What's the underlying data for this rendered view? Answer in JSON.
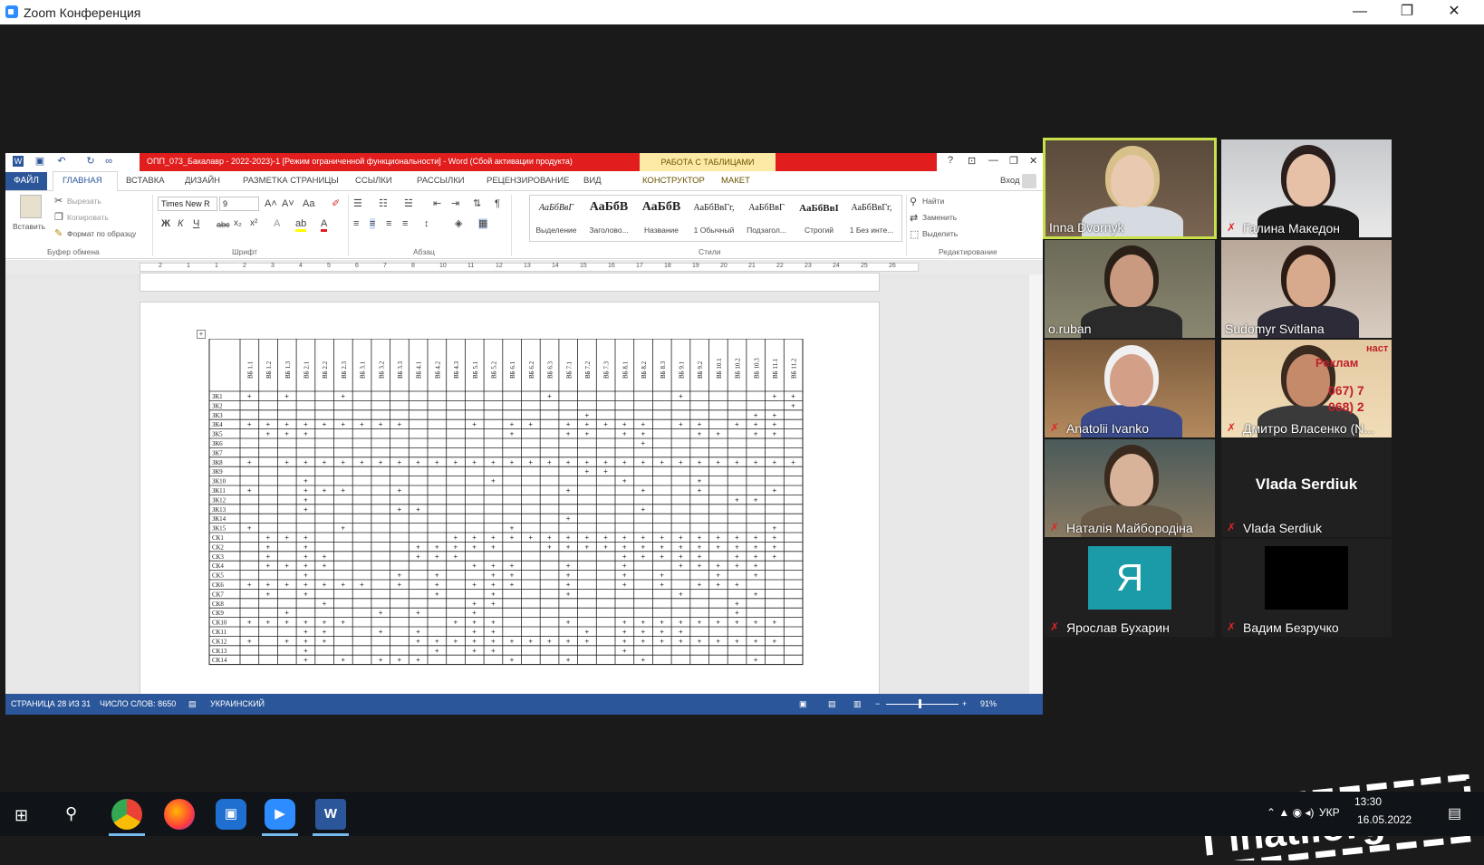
{
  "zoom": {
    "title": "Zoom Конференция",
    "controls": [
      "—",
      "❐",
      "✕"
    ]
  },
  "word": {
    "doc_title": "ОПП_073_Бакалавр - 2022-2023)-1 [Режим ограниченной функциональности] - Word (Сбой активации продукта)",
    "context_tab": "РАБОТА С ТАБЛИЦАМИ",
    "title_controls": [
      "?",
      "⊡",
      "—",
      "❐",
      "✕"
    ],
    "signin": "Вход",
    "tabs": [
      "ФАЙЛ",
      "ГЛАВНАЯ",
      "ВСТАВКА",
      "ДИЗАЙН",
      "РАЗМЕТКА СТРАНИЦЫ",
      "ССЫЛКИ",
      "РАССЫЛКИ",
      "РЕЦЕНЗИРОВАНИЕ",
      "ВИД",
      "КОНСТРУКТОР",
      "МАКЕТ"
    ],
    "clipboard": {
      "paste": "Вставить",
      "cut": "Вырезать",
      "copy": "Копировать",
      "format": "Формат по образцу",
      "group": "Буфер обмена"
    },
    "font": {
      "name": "Times New R",
      "size": "9",
      "group": "Шрифт",
      "bold": "Ж",
      "italic": "К",
      "underline": "Ч",
      "strike": "abc",
      "sub": "x₂",
      "sup": "x²"
    },
    "paragraph": {
      "group": "Абзац"
    },
    "styles": {
      "group": "Стили",
      "items": [
        {
          "preview": "АаБбВвГ",
          "name": "Выделение"
        },
        {
          "preview": "АаБбВ",
          "name": "Заголово..."
        },
        {
          "preview": "АаБбВ",
          "name": "Название"
        },
        {
          "preview": "АаБбВвГг,",
          "name": "1 Обычный"
        },
        {
          "preview": "АаБбВвГ",
          "name": "Подзагол..."
        },
        {
          "preview": "АаБбВвІ",
          "name": "Строгий"
        },
        {
          "preview": "АаБбВвГг,",
          "name": "1 Без инте..."
        }
      ]
    },
    "editing": {
      "find": "Найти",
      "replace": "Заменить",
      "select": "Выделить",
      "group": "Редактирование"
    },
    "ruler_numbers": [
      "2",
      "1",
      "1",
      "2",
      "3",
      "4",
      "5",
      "6",
      "7",
      "8",
      "10",
      "11",
      "12",
      "13",
      "14",
      "15",
      "16",
      "17",
      "18",
      "19",
      "20",
      "21",
      "22",
      "23",
      "24",
      "25",
      "26"
    ],
    "table": {
      "cols": [
        "ВБ 1.1",
        "ВБ 1.2",
        "ВБ 1.3",
        "ВБ 2.1",
        "ВБ 2.2",
        "ВБ 2.3",
        "ВБ 3.1",
        "ВБ 3.2",
        "ВБ 3.3",
        "ВБ 4.1",
        "ВБ 4.2",
        "ВБ 4.3",
        "ВБ 5.1",
        "ВБ 5.2",
        "ВБ 6.1",
        "ВБ 6.2",
        "ВБ 6.3",
        "ВБ 7.1",
        "ВБ 7.2",
        "ВБ 7.3",
        "ВБ 8.1",
        "ВБ 8.2",
        "ВБ 8.3",
        "ВБ 9.1",
        "ВБ 9.2",
        "ВБ 10.1",
        "ВБ 10.2",
        "ВБ 10.3",
        "ВБ 11.1",
        "ВБ 11.2"
      ],
      "rows": [
        "ЗК1",
        "ЗК2",
        "ЗК3",
        "ЗК4",
        "ЗК5",
        "ЗК6",
        "ЗК7",
        "ЗК8",
        "ЗК9",
        "ЗК10",
        "ЗК11",
        "ЗК12",
        "ЗК13",
        "ЗК14",
        "ЗК15",
        "СК1",
        "СК2",
        "СК3",
        "СК4",
        "СК5",
        "СК6",
        "СК7",
        "СК8",
        "СК9",
        "СК10",
        "СК11",
        "СК12",
        "СК13",
        "СК14"
      ],
      "marks": [
        [
          0,
          2,
          5,
          16,
          23,
          28,
          29
        ],
        [
          29
        ],
        [
          18,
          27,
          28
        ],
        [
          0,
          1,
          2,
          3,
          4,
          5,
          6,
          7,
          8,
          12,
          14,
          15,
          17,
          18,
          19,
          20,
          21,
          23,
          24,
          26,
          27,
          28
        ],
        [
          1,
          2,
          3,
          14,
          17,
          18,
          20,
          21,
          24,
          25,
          27,
          28
        ],
        [
          21
        ],
        [],
        [
          0,
          2,
          3,
          4,
          5,
          6,
          7,
          8,
          9,
          10,
          11,
          12,
          13,
          14,
          15,
          16,
          17,
          18,
          19,
          20,
          21,
          22,
          23,
          24,
          25,
          26,
          27,
          28,
          29
        ],
        [
          18,
          19
        ],
        [
          3,
          13,
          20,
          24
        ],
        [
          0,
          3,
          4,
          5,
          8,
          17,
          21,
          24,
          28
        ],
        [
          3,
          26,
          27
        ],
        [
          3,
          8,
          9,
          21
        ],
        [
          17
        ],
        [
          0,
          5,
          14,
          28
        ],
        [
          1,
          2,
          3,
          11,
          12,
          13,
          14,
          15,
          16,
          17,
          18,
          19,
          20,
          21,
          22,
          23,
          24,
          25,
          26,
          27,
          28
        ],
        [
          1,
          3,
          9,
          10,
          11,
          12,
          13,
          16,
          17,
          18,
          19,
          20,
          21,
          22,
          23,
          24,
          25,
          26,
          27,
          28
        ],
        [
          1,
          3,
          4,
          9,
          10,
          11,
          20,
          21,
          22,
          23,
          24,
          26,
          27,
          28
        ],
        [
          1,
          2,
          3,
          4,
          12,
          13,
          14,
          17,
          20,
          23,
          24,
          25,
          26,
          27
        ],
        [
          3,
          8,
          10,
          13,
          14,
          17,
          20,
          22,
          25,
          27
        ],
        [
          0,
          1,
          2,
          3,
          4,
          5,
          6,
          8,
          10,
          12,
          13,
          14,
          17,
          20,
          22,
          24,
          25,
          26
        ],
        [
          1,
          3,
          10,
          13,
          17,
          23,
          27
        ],
        [
          4,
          12,
          13,
          26
        ],
        [
          2,
          7,
          9,
          12,
          26
        ],
        [
          0,
          1,
          2,
          3,
          4,
          5,
          11,
          12,
          13,
          17,
          20,
          21,
          22,
          23,
          24,
          25,
          26,
          27,
          28
        ],
        [
          3,
          4,
          7,
          9,
          12,
          13,
          18,
          20,
          21,
          22,
          23
        ],
        [
          0,
          2,
          3,
          4,
          9,
          10,
          11,
          12,
          13,
          14,
          15,
          16,
          17,
          18,
          20,
          21,
          22,
          23,
          24,
          25,
          26,
          27,
          28
        ],
        [
          3,
          10,
          12,
          13,
          20
        ],
        [
          3,
          5,
          7,
          8,
          9,
          14,
          17,
          21,
          27
        ]
      ]
    },
    "status": {
      "page": "СТРАНИЦА 28 ИЗ 31",
      "words": "ЧИСЛО СЛОВ: 8650",
      "lang": "УКРАИНСКИЙ",
      "zoom": "91%"
    }
  },
  "participants": [
    {
      "name": "Inna Dvornyk",
      "muted": false,
      "speaking": true
    },
    {
      "name": "Галина Македон",
      "muted": true
    },
    {
      "name": "o.ruban",
      "muted": false
    },
    {
      "name": "Sudomyr Svitlana",
      "muted": false
    },
    {
      "name": "Anatolii Ivanko",
      "muted": true
    },
    {
      "name": "Дмитро Власенко (N...",
      "muted": true
    },
    {
      "name": "Наталія Майбородіна",
      "muted": true
    },
    {
      "name": "Vlada Serdiuk",
      "muted": true,
      "big": "Vlada Serdiuk"
    },
    {
      "name": "Ярослав Бухарин",
      "muted": true,
      "avatar": "Я",
      "avatar_color": "#1b9aa8"
    },
    {
      "name": "Вадим Безручко",
      "muted": true
    }
  ],
  "tile_texts": {
    "advert": "Реклам",
    "phone1": "067) 7",
    "phone2": "068) 2",
    "brand": "наст"
  },
  "taskbar": {
    "lang": "УКР",
    "time": "13:30",
    "date": "16.05.2022"
  },
  "watermark": "inati.org.ua",
  "colors": {
    "word_blue": "#2b579a",
    "zoom_blue": "#2d8cff",
    "active_border": "#c8e04a",
    "mute_red": "#e02424"
  }
}
